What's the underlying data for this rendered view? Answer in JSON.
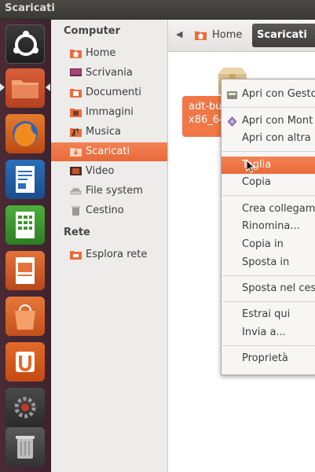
{
  "window": {
    "title": "Scaricati"
  },
  "launcher": {
    "items": [
      {
        "name": "ubuntu-logo-icon"
      },
      {
        "name": "folder-icon"
      },
      {
        "name": "firefox-icon"
      },
      {
        "name": "writer-icon"
      },
      {
        "name": "calc-icon"
      },
      {
        "name": "impress-icon"
      },
      {
        "name": "software-center-icon"
      },
      {
        "name": "ubuntu-one-icon"
      },
      {
        "name": "settings-icon"
      },
      {
        "name": "trash-icon"
      }
    ]
  },
  "sidebar": {
    "sections": [
      {
        "title": "Computer",
        "items": [
          {
            "label": "Home",
            "icon": "home-folder-icon"
          },
          {
            "label": "Scrivania",
            "icon": "desktop-icon"
          },
          {
            "label": "Documenti",
            "icon": "documents-icon"
          },
          {
            "label": "Immagini",
            "icon": "pictures-icon"
          },
          {
            "label": "Musica",
            "icon": "music-icon"
          },
          {
            "label": "Scaricati",
            "icon": "downloads-icon",
            "selected": true
          },
          {
            "label": "Video",
            "icon": "videos-icon"
          },
          {
            "label": "File system",
            "icon": "drive-icon"
          },
          {
            "label": "Cestino",
            "icon": "trash-icon"
          }
        ]
      },
      {
        "title": "Rete",
        "items": [
          {
            "label": "Esplora rete",
            "icon": "network-icon"
          }
        ]
      }
    ]
  },
  "pathbar": {
    "home": "Home",
    "current": "Scaricati"
  },
  "file": {
    "name_line1": "adt-bu",
    "name_line2": "x86_64"
  },
  "context_menu": {
    "items": [
      "Apri con Gesto",
      "Apri con Mont",
      "Apri con altra",
      "Taglia",
      "Copia",
      "Crea collegam",
      "Rinomina...",
      "Copia in",
      "Sposta in",
      "Sposta nel ces",
      "Estrai qui",
      "Invia a...",
      "Proprietà"
    ],
    "highlighted": "Taglia"
  },
  "colors": {
    "accent": "#ef7240",
    "launcher": "#432833"
  }
}
